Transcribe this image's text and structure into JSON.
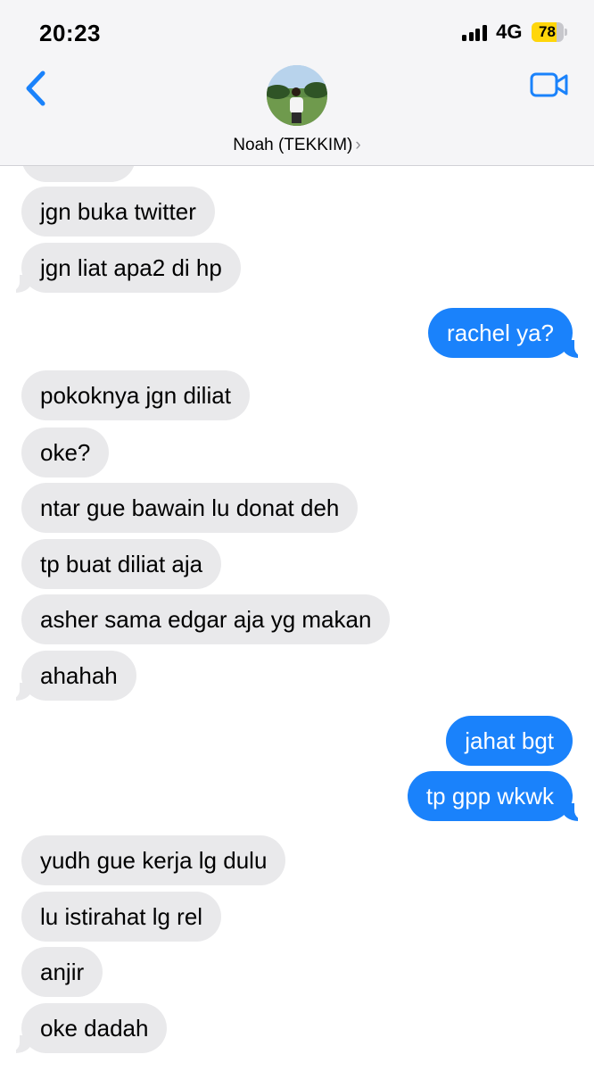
{
  "status_bar": {
    "time": "20:23",
    "network": "4G",
    "battery_percent": "78",
    "battery_level": 0.78,
    "battery_color": "#ffd60a"
  },
  "header": {
    "contact_name": "Noah (TEKKIM)",
    "chevron": "›",
    "back_icon": "chevron-left-icon",
    "video_icon": "video-camera-icon",
    "accent_color": "#1a82fb"
  },
  "messages": [
    {
      "side": "in",
      "text": "jgn buka twitter"
    },
    {
      "side": "in",
      "text": "jgn liat apa2 di hp"
    },
    {
      "side": "out",
      "text": "rachel ya?"
    },
    {
      "side": "in",
      "text": "pokoknya jgn diliat"
    },
    {
      "side": "in",
      "text": "oke?"
    },
    {
      "side": "in",
      "text": "ntar gue bawain lu donat deh"
    },
    {
      "side": "in",
      "text": "tp buat diliat aja"
    },
    {
      "side": "in",
      "text": "asher sama edgar aja yg makan"
    },
    {
      "side": "in",
      "text": "ahahah"
    },
    {
      "side": "out",
      "text": "jahat bgt"
    },
    {
      "side": "out",
      "text": "tp gpp wkwk"
    },
    {
      "side": "in",
      "text": "yudh gue kerja lg dulu"
    },
    {
      "side": "in",
      "text": "lu istirahat lg rel"
    },
    {
      "side": "in",
      "text": "anjir"
    },
    {
      "side": "in",
      "text": "oke dadah"
    }
  ],
  "colors": {
    "incoming_bubble": "#e9e9eb",
    "outgoing_bubble": "#1a82fb",
    "header_background": "#f5f5f7"
  }
}
